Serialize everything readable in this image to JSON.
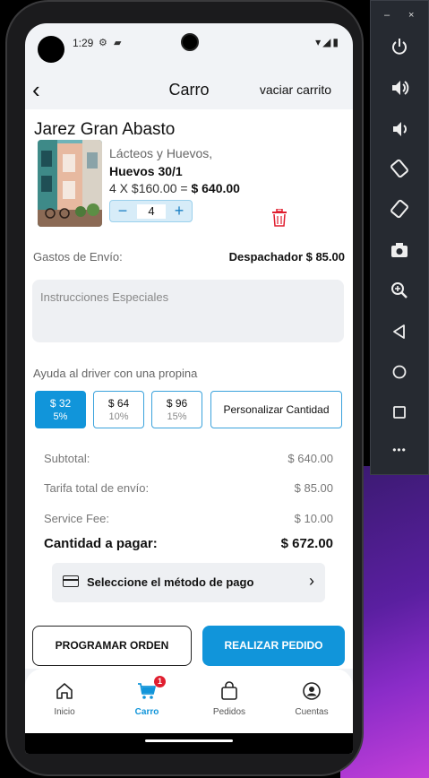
{
  "statusbar": {
    "time": "1:29",
    "right_icons": "▾◢▮"
  },
  "header": {
    "title": "Carro",
    "empty_cart": "vaciar carrito"
  },
  "store": {
    "name": "Jarez Gran Abasto"
  },
  "product": {
    "category": "Lácteos y Huevos,",
    "name": "Huevos 30/1",
    "price_line": "4 X $160.00 = ",
    "line_total": "$ 640.00",
    "quantity": "4",
    "minus": "−",
    "plus": "+"
  },
  "shipping": {
    "label": "Gastos de Envío:",
    "value": "Despachador $ 85.00"
  },
  "instructions": {
    "placeholder": "Instrucciones Especiales"
  },
  "tips": {
    "label": "Ayuda al driver con una propina",
    "options": [
      {
        "amount": "$ 32",
        "percent": "5%",
        "selected": true
      },
      {
        "amount": "$ 64",
        "percent": "10%",
        "selected": false
      },
      {
        "amount": "$ 96",
        "percent": "15%",
        "selected": false
      }
    ],
    "custom": "Personalizar Cantidad"
  },
  "summary": {
    "subtotal_label": "Subtotal:",
    "subtotal_value": "$ 640.00",
    "shipping_label": "Tarifa total de envío:",
    "shipping_value": "$ 85.00",
    "service_label": "Service Fee:",
    "service_value": "$ 10.00",
    "total_label": "Cantidad a pagar:",
    "total_value": "$ 672.00"
  },
  "payment": {
    "label": "Seleccione el método de pago"
  },
  "actions": {
    "schedule": "PROGRAMAR ORDEN",
    "order": "REALIZAR PEDIDO"
  },
  "tabs": [
    {
      "label": "Inicio",
      "icon": "home-icon"
    },
    {
      "label": "Carro",
      "icon": "cart-icon",
      "badge": "1",
      "active": true
    },
    {
      "label": "Pedidos",
      "icon": "bag-icon"
    },
    {
      "label": "Cuentas",
      "icon": "account-icon"
    }
  ],
  "emulator": {
    "minimize": "–",
    "close": "×",
    "more": "•••"
  },
  "colors": {
    "accent": "#1195da",
    "danger": "#e01e2f"
  }
}
